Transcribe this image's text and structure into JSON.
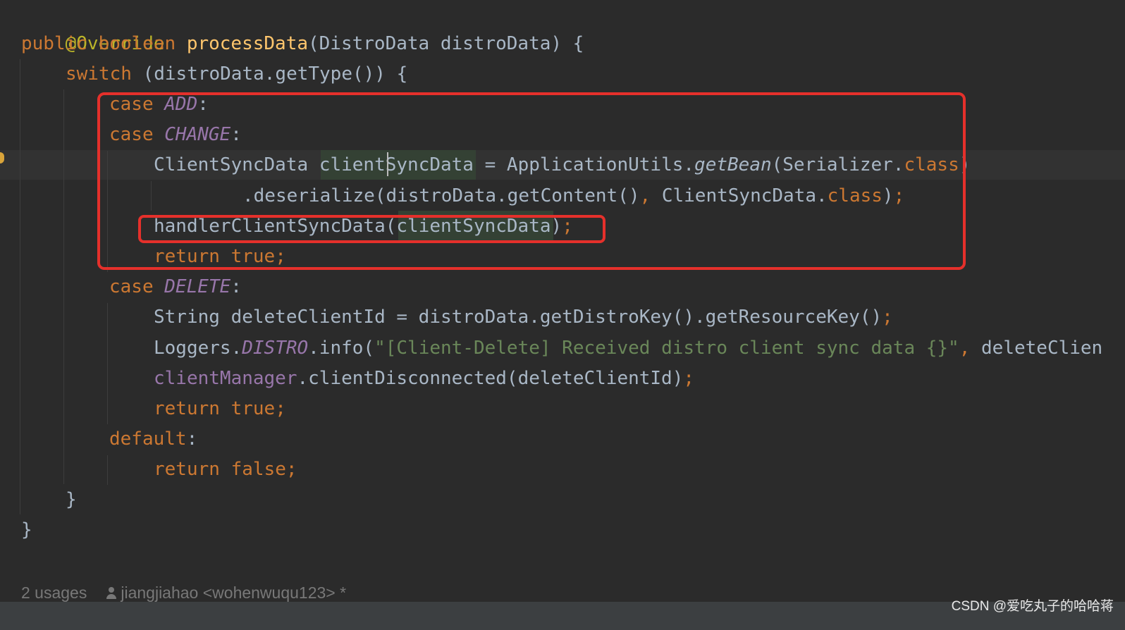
{
  "colors": {
    "background": "#2b2b2b",
    "keyword": "#cc7832",
    "method_decl": "#ffc66d",
    "annotation": "#bbb529",
    "constant": "#9876aa",
    "string": "#6a8759",
    "plain": "#a9b7c6",
    "highlight_box": "#e5302b"
  },
  "code": {
    "l1": {
      "annotation": "@Override"
    },
    "l2": {
      "kw1": "public",
      "kw2": "boolean",
      "method": "processData",
      "params": "(DistroData distroData) {"
    },
    "l3": {
      "kw": "switch",
      "rest": " (distroData.getType()) {"
    },
    "l4": {
      "kw": "case",
      "const": "ADD",
      "colon": ":"
    },
    "l5": {
      "kw": "case",
      "const": "CHANGE",
      "colon": ":"
    },
    "l6": {
      "type": "ClientSyncData ",
      "var": "clientSyncData",
      "assign": " = ApplicationUtils.",
      "call": "getBean",
      "args": "(Serializer.",
      "kw": "class",
      "close": ")"
    },
    "l7": {
      "call": ".deserialize(distroData.getContent()",
      "comma": ",",
      "arg": " ClientSyncData.",
      "kw": "class",
      "close": ")",
      "semi": ";"
    },
    "l8": {
      "call": "handlerClientSyncData(",
      "arg": "clientSyncData",
      "close": ")",
      "semi": ";"
    },
    "l9": {
      "kw": "return",
      "val": "true",
      "semi": ";"
    },
    "l10": {
      "kw": "case",
      "const": "DELETE",
      "colon": ":"
    },
    "l11": {
      "text": "String deleteClientId = distroData.getDistroKey().getResourceKey()",
      "semi": ";"
    },
    "l12": {
      "obj": "Loggers.",
      "field": "DISTRO",
      "call": ".info(",
      "str": "\"[Client-Delete] Received distro client sync data {}\"",
      "comma": ",",
      "arg": " deleteClien"
    },
    "l13": {
      "field": "clientManager",
      "call": ".clientDisconnected(deleteClientId)",
      "semi": ";"
    },
    "l14": {
      "kw": "return",
      "val": "true",
      "semi": ";"
    },
    "l15": {
      "kw": "default",
      "colon": ":"
    },
    "l16": {
      "kw": "return",
      "val": "false",
      "semi": ";"
    },
    "l17": {
      "text": "}"
    },
    "l18": {
      "text": "}"
    }
  },
  "footer": {
    "usages": "2 usages",
    "author": "jiangjiahao <wohenwuqu123> *"
  },
  "watermark": "CSDN @爱吃丸子的哈哈蒋"
}
